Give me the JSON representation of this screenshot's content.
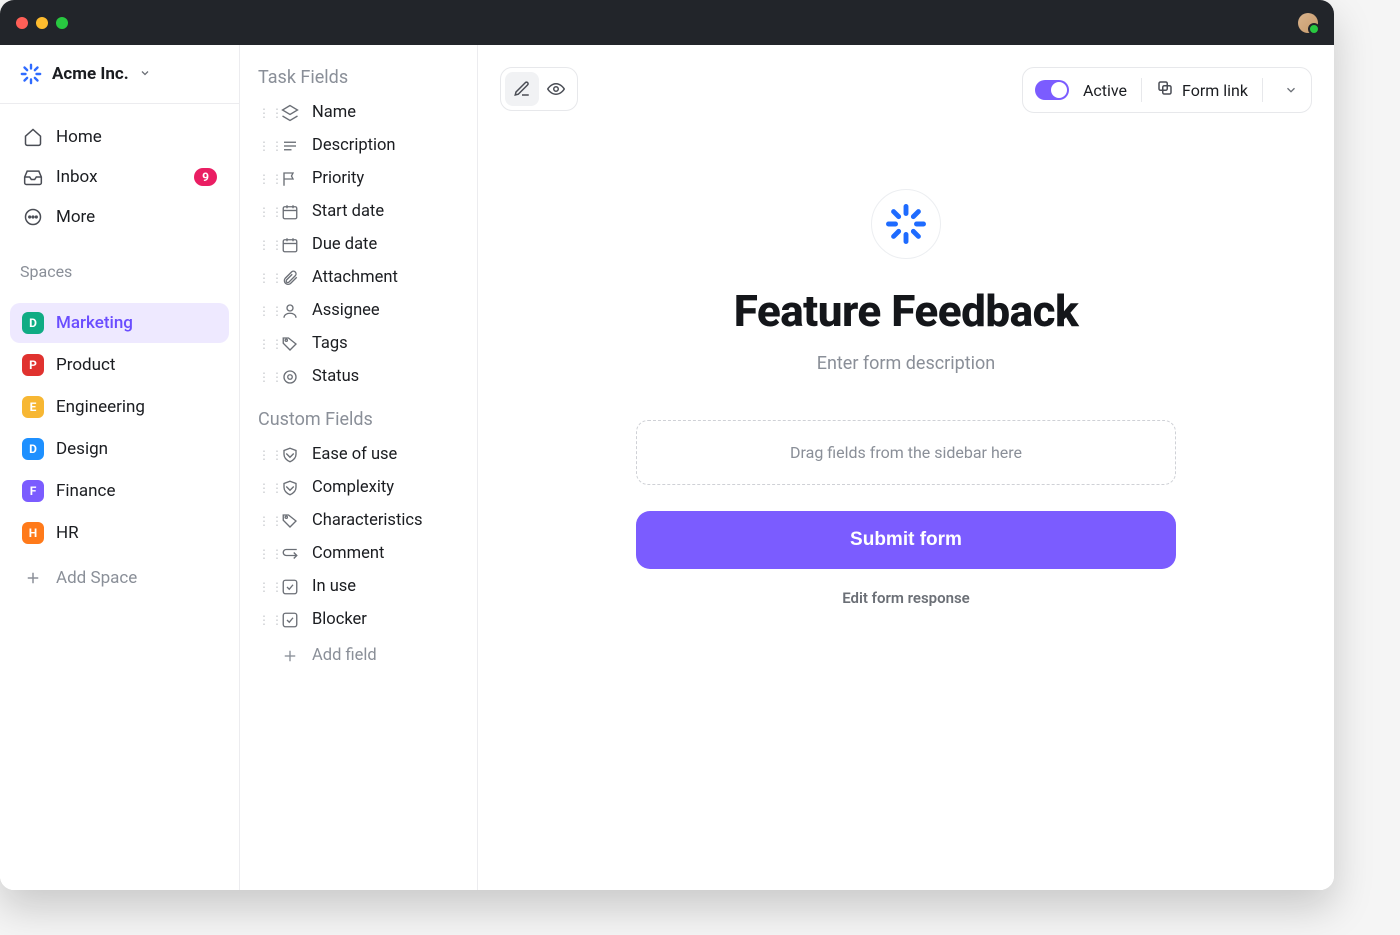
{
  "workspace": {
    "name": "Acme Inc."
  },
  "nav": {
    "home": "Home",
    "inbox": "Inbox",
    "inbox_badge": "9",
    "more": "More"
  },
  "spaces_title": "Spaces",
  "spaces": [
    {
      "letter": "D",
      "label": "Marketing",
      "color": "#10ac84",
      "active": true
    },
    {
      "letter": "P",
      "label": "Product",
      "color": "#e0322f",
      "active": false
    },
    {
      "letter": "E",
      "label": "Engineering",
      "color": "#f7b733",
      "active": false
    },
    {
      "letter": "D",
      "label": "Design",
      "color": "#1e90ff",
      "active": false
    },
    {
      "letter": "F",
      "label": "Finance",
      "color": "#7b5cff",
      "active": false
    },
    {
      "letter": "H",
      "label": "HR",
      "color": "#ff7a1a",
      "active": false
    }
  ],
  "add_space": "Add Space",
  "fields": {
    "task_title": "Task Fields",
    "task": [
      {
        "icon": "layers",
        "label": "Name"
      },
      {
        "icon": "text",
        "label": "Description"
      },
      {
        "icon": "flag",
        "label": "Priority"
      },
      {
        "icon": "calendar",
        "label": "Start date"
      },
      {
        "icon": "calendar",
        "label": "Due date"
      },
      {
        "icon": "clip",
        "label": "Attachment"
      },
      {
        "icon": "user",
        "label": "Assignee"
      },
      {
        "icon": "tag",
        "label": "Tags"
      },
      {
        "icon": "target",
        "label": "Status"
      }
    ],
    "custom_title": "Custom Fields",
    "custom": [
      {
        "icon": "shield",
        "label": "Ease of use"
      },
      {
        "icon": "shield",
        "label": "Complexity"
      },
      {
        "icon": "tag",
        "label": "Characteristics"
      },
      {
        "icon": "comment",
        "label": "Comment"
      },
      {
        "icon": "check",
        "label": "In use"
      },
      {
        "icon": "check",
        "label": "Blocker"
      }
    ],
    "add_field": "Add field"
  },
  "toolbar": {
    "active_label": "Active",
    "form_link": "Form link"
  },
  "form": {
    "title": "Feature Feedback",
    "description_placeholder": "Enter form description",
    "dropzone": "Drag fields from the sidebar here",
    "submit": "Submit form",
    "edit_response": "Edit form response"
  }
}
